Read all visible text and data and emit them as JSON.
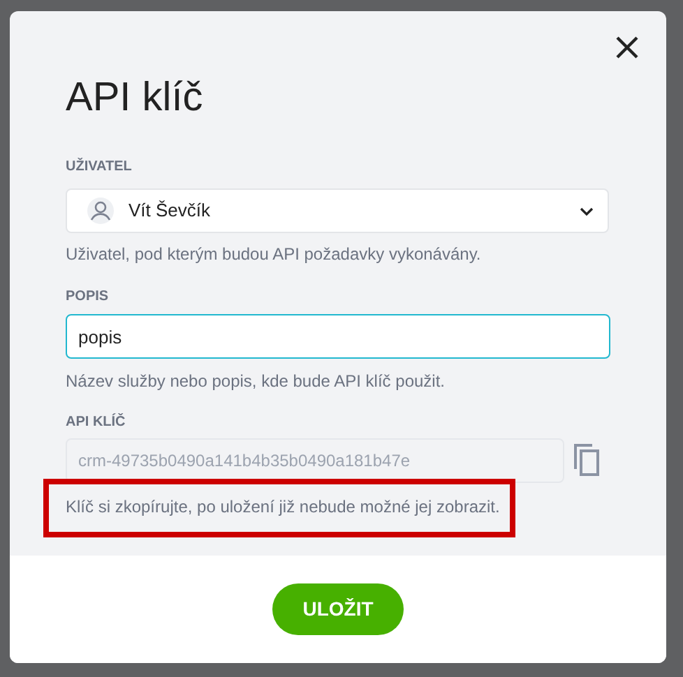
{
  "dialog": {
    "title": "API klíč"
  },
  "user": {
    "label": "UŽIVATEL",
    "value": "Vít Ševčík",
    "hint": "Uživatel, pod kterým budou API požadavky vykonávány."
  },
  "description": {
    "label": "POPIS",
    "value": "popis",
    "focused": true,
    "hint": "Název služby nebo popis, kde bude API klíč použit."
  },
  "api_key": {
    "label": "API KLÍČ",
    "value": "crm-49735b0490a141b4b35b0490a181b47e",
    "disabled": true,
    "hint": "Klíč si zkopírujte, po uložení již nebude možné jej zobrazit.",
    "highlighted": true
  },
  "buttons": [
    {
      "label": "ULOŽIT"
    }
  ]
}
